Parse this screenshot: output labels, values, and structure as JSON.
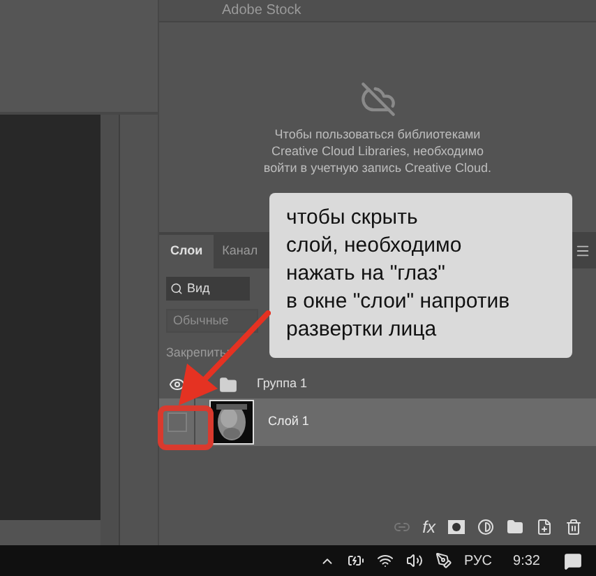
{
  "stock_header": {
    "text": "Adobe Stock"
  },
  "libraries": {
    "message": "Чтобы пользоваться библиотеками\nCreative Cloud Libraries, необходимо\nвойти в учетную запись Creative Cloud."
  },
  "layers_panel": {
    "tabs": [
      {
        "label": "Слои",
        "selected": true
      },
      {
        "label": "Канал",
        "selected": false
      }
    ],
    "search": {
      "value": "Вид"
    },
    "blend_mode": {
      "value": "Обычные"
    },
    "lock": {
      "label": "Закрепить:"
    },
    "layers": [
      {
        "kind": "group",
        "name": "Группа 1",
        "visible": true,
        "selected": false
      },
      {
        "kind": "layer",
        "name": "Слой 1",
        "visible": false,
        "selected": true
      }
    ]
  },
  "bottom_bar": {
    "effects_label": "fx"
  },
  "tooltip": {
    "text": "чтобы скрыть\nслой, необходимо\nнажать на \"глаз\"\nв окне \"слои\" напротив\nразвертки лица"
  },
  "taskbar": {
    "language": "РУС",
    "time": "9:32"
  }
}
